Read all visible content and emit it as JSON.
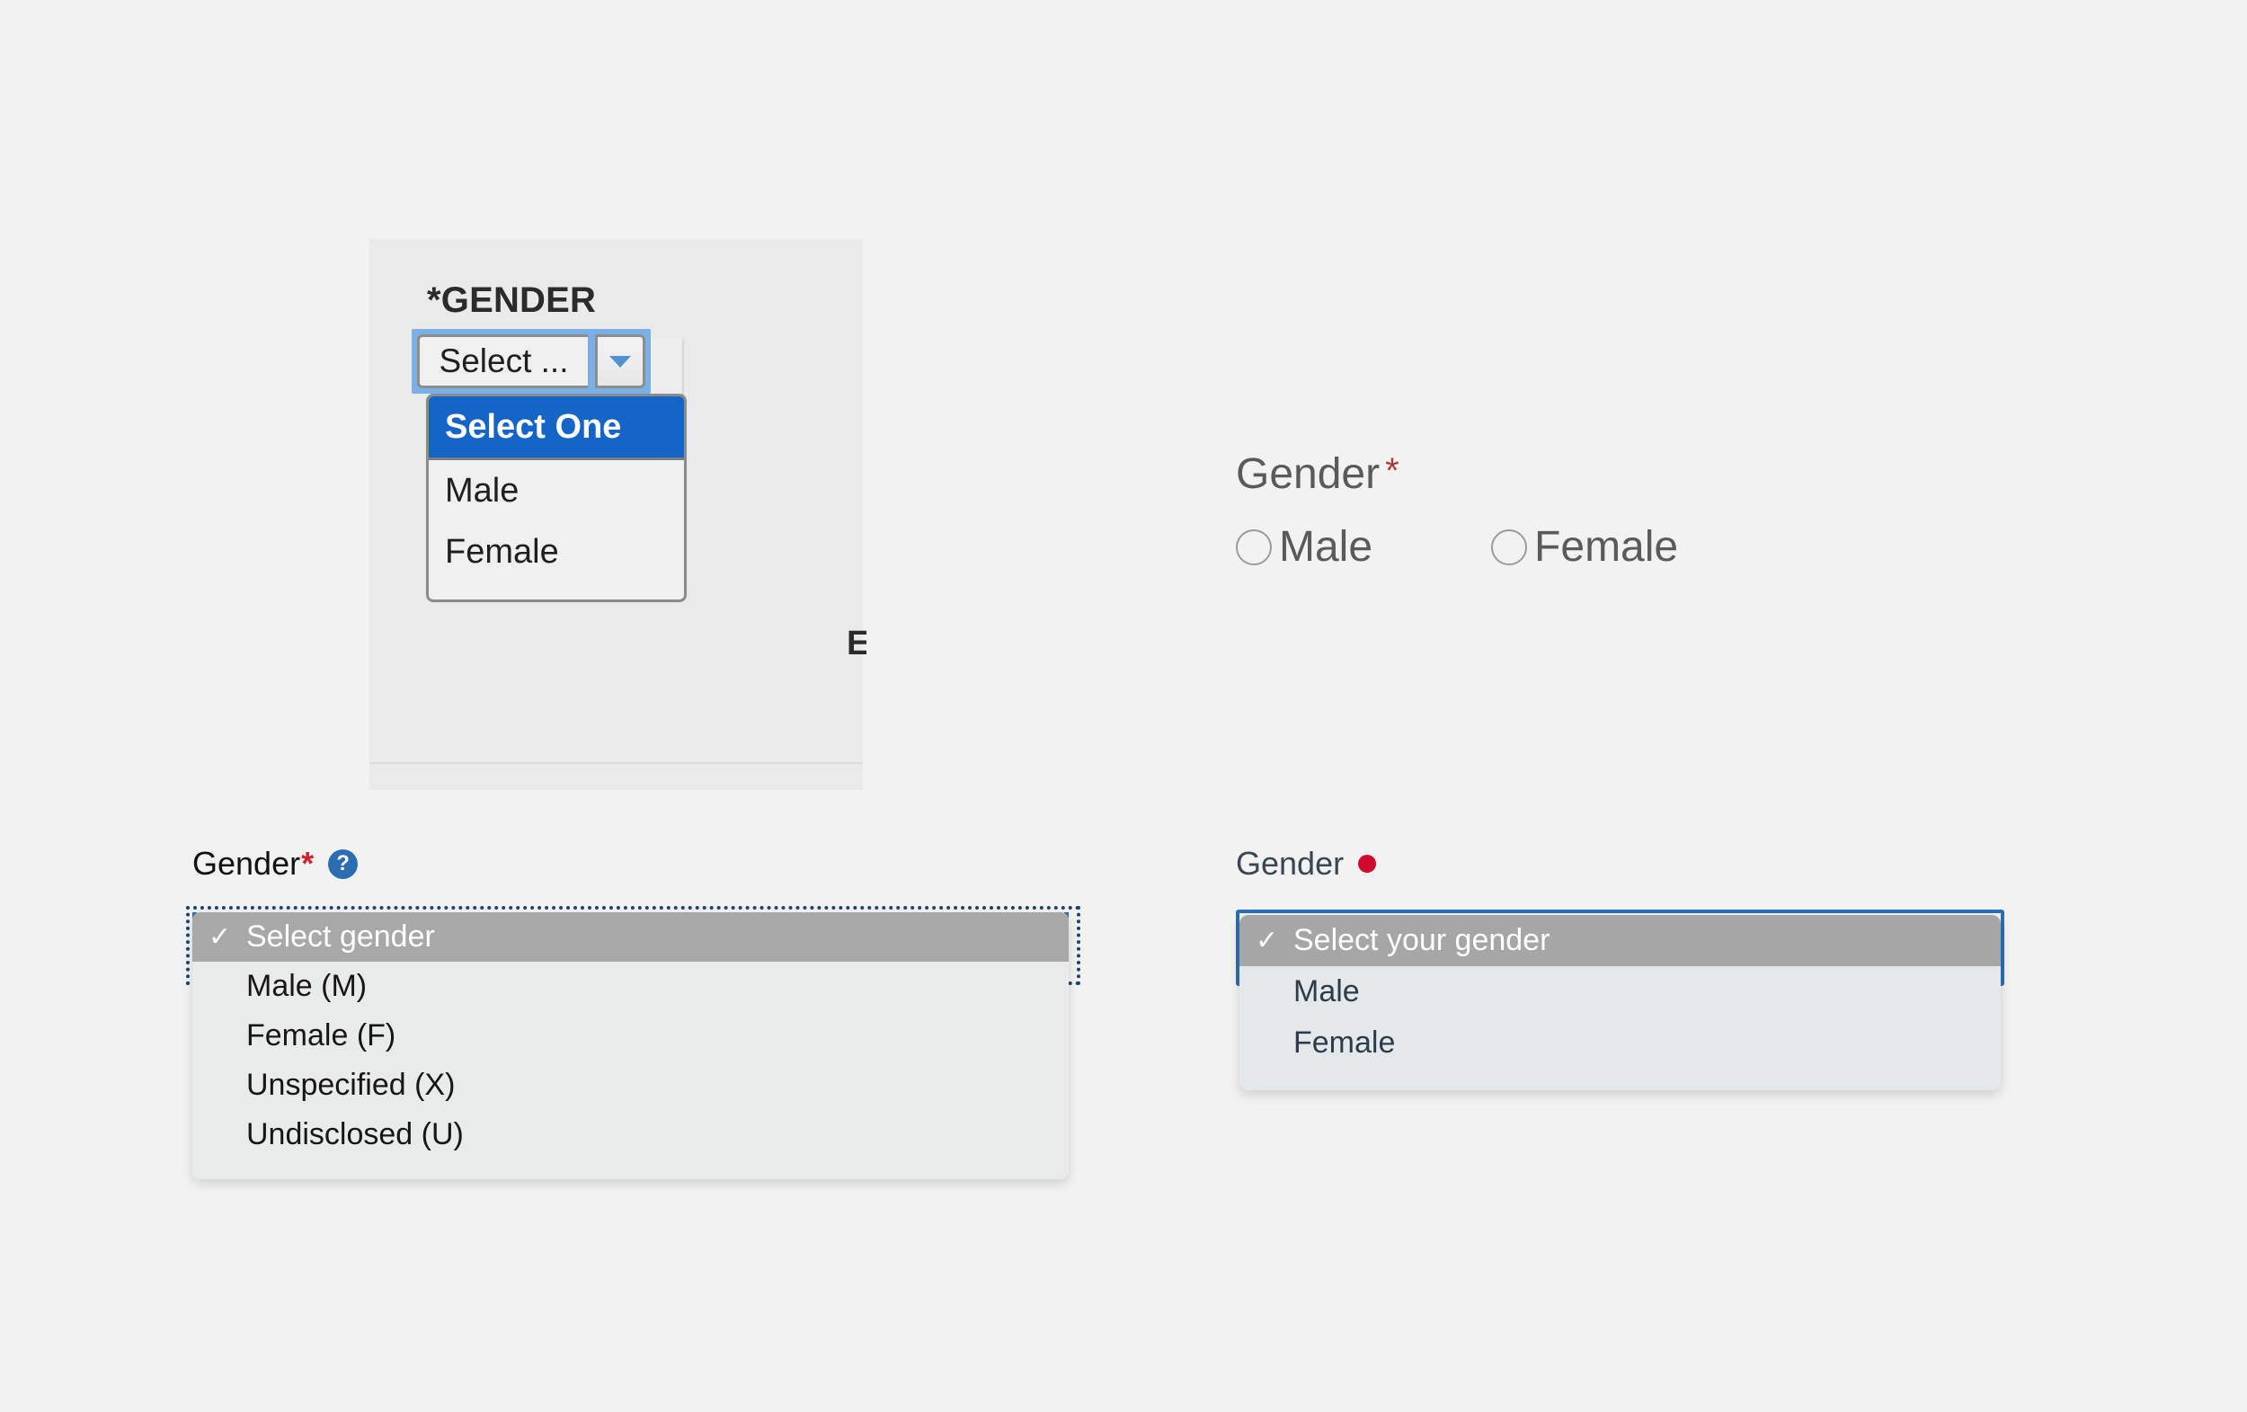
{
  "page": {
    "background_color": "#f2f2f2",
    "title": "Gender field UI variations"
  },
  "panel_a": {
    "name": "classic-desktop-combobox",
    "background_color": "#eaeaea",
    "label": "*GENDER",
    "field_value": "Select ...",
    "dropdown_arrow_icon": "chevron-down-icon",
    "arrow_color": "#4f93cf",
    "focus_ring_color": "#79b0e8",
    "cut_off_label": "E",
    "options": [
      {
        "label": "Select One",
        "selected": true
      },
      {
        "label": "Male",
        "selected": false
      },
      {
        "label": "Female",
        "selected": false
      }
    ],
    "selected_highlight_color": "#1565c8"
  },
  "panel_b": {
    "name": "radio-group",
    "label": "Gender",
    "required_marker": "*",
    "required_marker_color": "#b03a3a",
    "text_color": "#5a5a5a",
    "options": [
      {
        "label": "Male",
        "checked": false
      },
      {
        "label": "Female",
        "checked": false
      }
    ]
  },
  "panel_c": {
    "name": "native-select-dotted-focus",
    "label": "Gender",
    "required_marker": "*",
    "required_marker_color": "#d32030",
    "help_icon": "question-mark-help-icon",
    "help_icon_glyph": "?",
    "help_icon_color": "#2a6db0",
    "focus_ring_color": "#1f4372",
    "focus_border_color": "#2a6eb8",
    "checkmark_glyph": "✓",
    "options": [
      {
        "label": "Select gender",
        "selected": true
      },
      {
        "label": "Male (M)",
        "selected": false
      },
      {
        "label": "Female (F)",
        "selected": false
      },
      {
        "label": "Unspecified (X)",
        "selected": false
      },
      {
        "label": "Undisclosed (U)",
        "selected": false
      }
    ],
    "selected_highlight_color": "#a8a8a8"
  },
  "panel_d": {
    "name": "native-select-blue-focus",
    "label": "Gender",
    "required_marker": "dot",
    "required_marker_color": "#cf0a2c",
    "focus_border_color": "#2a6eb8",
    "text_color": "#3a4653",
    "checkmark_glyph": "✓",
    "options": [
      {
        "label": "Select your gender",
        "selected": true
      },
      {
        "label": "Male",
        "selected": false
      },
      {
        "label": "Female",
        "selected": false
      }
    ],
    "selected_highlight_color": "#a6a6a6"
  }
}
